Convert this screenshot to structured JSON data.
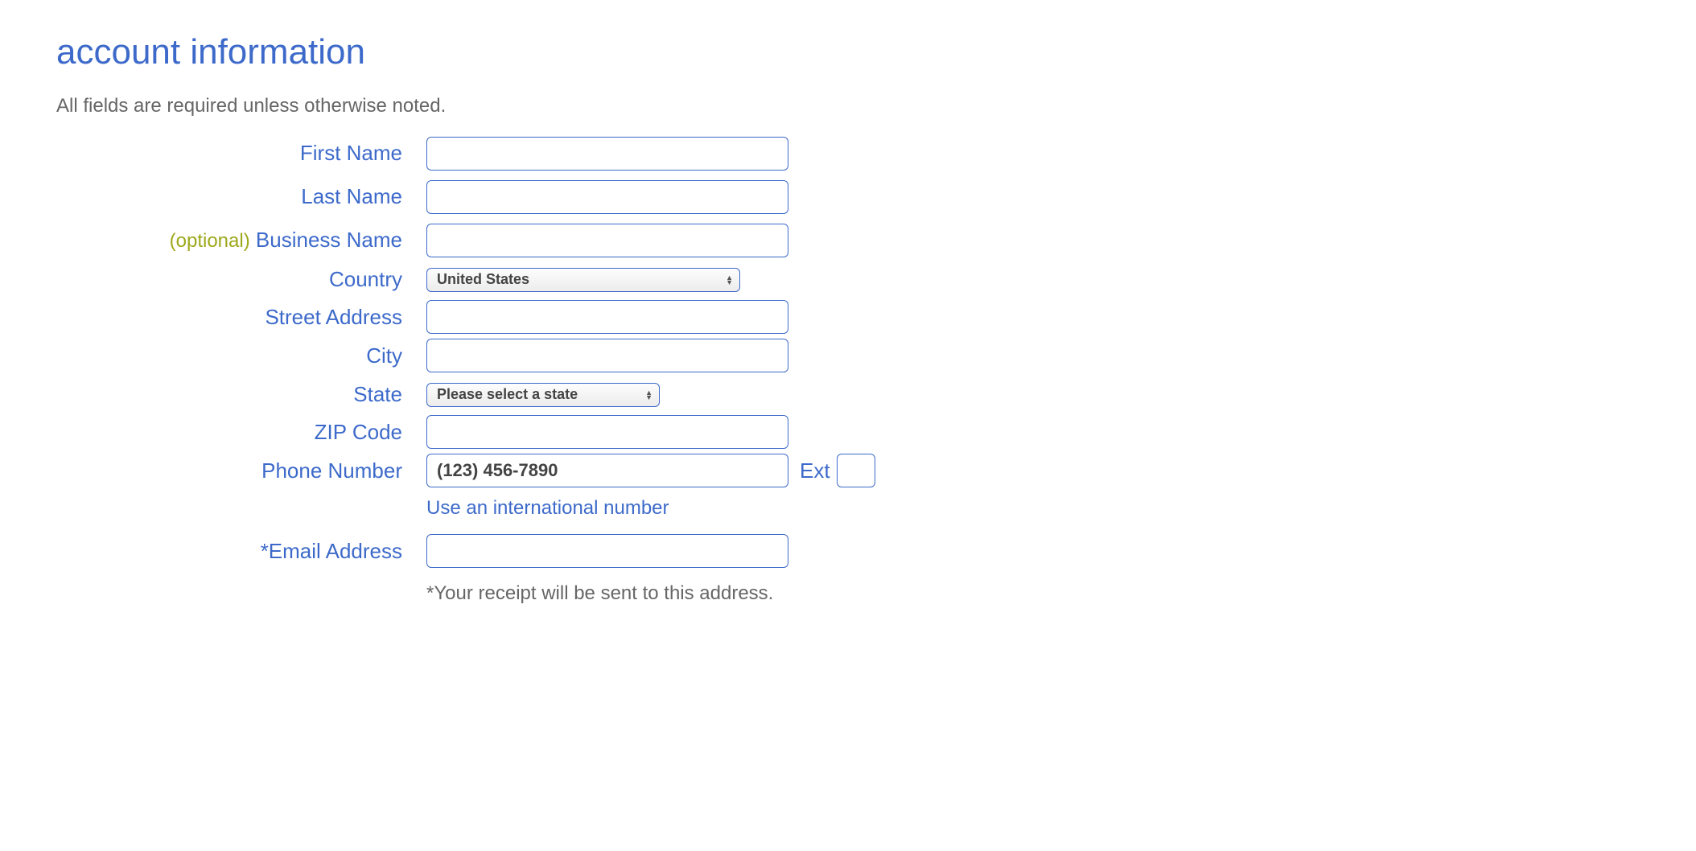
{
  "heading": "account information",
  "subtext": "All fields are required unless otherwise noted.",
  "labels": {
    "first_name": "First Name",
    "last_name": "Last Name",
    "business_optional": "(optional)",
    "business_name": "Business Name",
    "country": "Country",
    "street": "Street Address",
    "city": "City",
    "state": "State",
    "zip": "ZIP Code",
    "phone": "Phone Number",
    "ext": "Ext",
    "email": "*Email Address"
  },
  "values": {
    "first_name": "",
    "last_name": "",
    "business_name": "",
    "country_selected": "United States",
    "street": "",
    "city": "",
    "state_selected": "Please select a state",
    "zip": "",
    "phone": "",
    "phone_placeholder": "(123) 456-7890",
    "ext": "",
    "email": ""
  },
  "intl_link": "Use an international number",
  "email_footnote": "*Your receipt will be sent to this address."
}
